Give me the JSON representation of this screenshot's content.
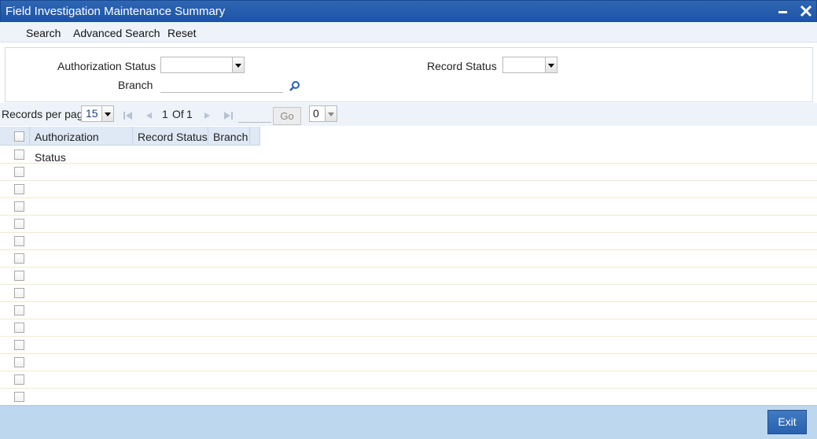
{
  "window": {
    "title": "Field Investigation Maintenance Summary"
  },
  "menu": {
    "search": "Search",
    "advanced_search": "Advanced Search",
    "reset": "Reset"
  },
  "criteria": {
    "authorization_status_label": "Authorization Status",
    "record_status_label": "Record Status",
    "branch_label": "Branch",
    "authorization_status_value": "",
    "record_status_value": "",
    "branch_value": ""
  },
  "pager": {
    "records_per_page_label": "Records per page",
    "records_per_page_value": "15",
    "current_page": "1",
    "of_label": "Of",
    "total_pages": "1",
    "go_label": "Go",
    "goto_value": "",
    "zero_value": "0"
  },
  "grid": {
    "columns": [
      "Authorization Status",
      "Record Status",
      "Branch"
    ],
    "row_count": 15
  },
  "footer": {
    "exit_label": "Exit"
  },
  "icons": [
    "minimize-icon",
    "close-icon",
    "search-lov-icon",
    "first-page-icon",
    "prev-page-icon",
    "next-page-icon",
    "last-page-icon"
  ]
}
